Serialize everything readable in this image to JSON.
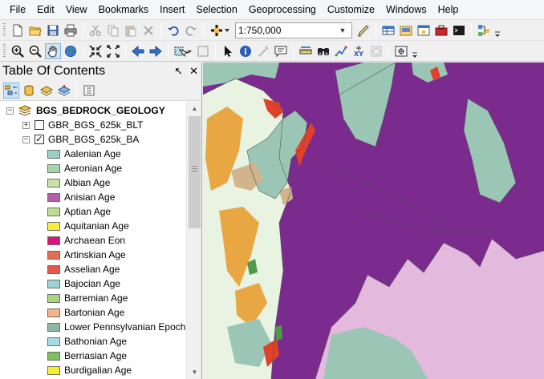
{
  "menu": [
    "File",
    "Edit",
    "View",
    "Bookmarks",
    "Insert",
    "Selection",
    "Geoprocessing",
    "Customize",
    "Windows",
    "Help"
  ],
  "toolbar": {
    "scale_value": "1:750,000",
    "standard_icons": [
      "new-document-icon",
      "open-folder-icon",
      "save-icon",
      "print-icon",
      "cut-icon",
      "copy-icon",
      "paste-icon",
      "delete-icon",
      "undo-icon",
      "redo-icon",
      "add-data-icon"
    ],
    "right_icons": [
      "editor-icon",
      "table-icon",
      "catalog-icon",
      "search-window-icon",
      "arctoolbox-icon",
      "python-icon",
      "model-builder-icon"
    ],
    "tools_icons": [
      "zoom-in-icon",
      "zoom-out-icon",
      "pan-icon",
      "full-extent-icon",
      "fixed-zoom-in-icon",
      "fixed-zoom-out-icon",
      "back-extent-icon",
      "forward-extent-icon",
      "select-features-icon",
      "clear-selection-icon",
      "select-elements-icon",
      "identify-icon",
      "hyperlink-icon",
      "html-popup-icon",
      "measure-icon",
      "find-icon",
      "find-route-icon",
      "go-to-xy-icon",
      "time-slider-icon",
      "viewer-window-icon"
    ]
  },
  "toc": {
    "title": "Table Of Contents",
    "pin_symbol": "↖",
    "close_symbol": "✕",
    "tools": [
      "list-by-drawing-order-icon",
      "list-by-source-icon",
      "list-by-visibility-icon",
      "list-by-selection-icon",
      "options-icon"
    ],
    "group": {
      "name": "BGS_BEDROCK_GEOLOGY",
      "expander": "−"
    },
    "layers": [
      {
        "name": "GBR_BGS_625k_BLT",
        "expander": "+",
        "checked": false,
        "check_mark": ""
      },
      {
        "name": "GBR_BGS_625k_BA",
        "expander": "−",
        "checked": true,
        "check_mark": "✓"
      }
    ],
    "legend": [
      {
        "label": "Aalenian Age",
        "color": "#9ccfc4"
      },
      {
        "label": "Aeronian Age",
        "color": "#a9d6a8"
      },
      {
        "label": "Albian Age",
        "color": "#c8e2a4"
      },
      {
        "label": "Anisian Age",
        "color": "#b05fa8"
      },
      {
        "label": "Aptian Age",
        "color": "#bedd90"
      },
      {
        "label": "Aquitanian Age",
        "color": "#f7f03b"
      },
      {
        "label": "Archaean Eon",
        "color": "#e0127a"
      },
      {
        "label": "Artinskian Age",
        "color": "#e36c55"
      },
      {
        "label": "Asselian Age",
        "color": "#e6584a"
      },
      {
        "label": "Bajocian Age",
        "color": "#9fd3d3"
      },
      {
        "label": "Barremian Age",
        "color": "#a9d57f"
      },
      {
        "label": "Bartonian Age",
        "color": "#f4b58b"
      },
      {
        "label": "Lower Pennsylvanian Epoch",
        "color": "#8fb6a4"
      },
      {
        "label": "Bathonian Age",
        "color": "#a8dbe0"
      },
      {
        "label": "Berriasian Age",
        "color": "#7ec05b"
      },
      {
        "label": "Burdigalian Age",
        "color": "#f6ef2c"
      }
    ]
  },
  "map_colors": {
    "purple": "#7b2a8e",
    "pink": "#e3b9dd",
    "teal": "#9bc6b5",
    "orange": "#e8a743",
    "light_green": "#e9f3e1",
    "red": "#e0412a",
    "tan": "#d2b48c",
    "green": "#4f9a4a"
  }
}
